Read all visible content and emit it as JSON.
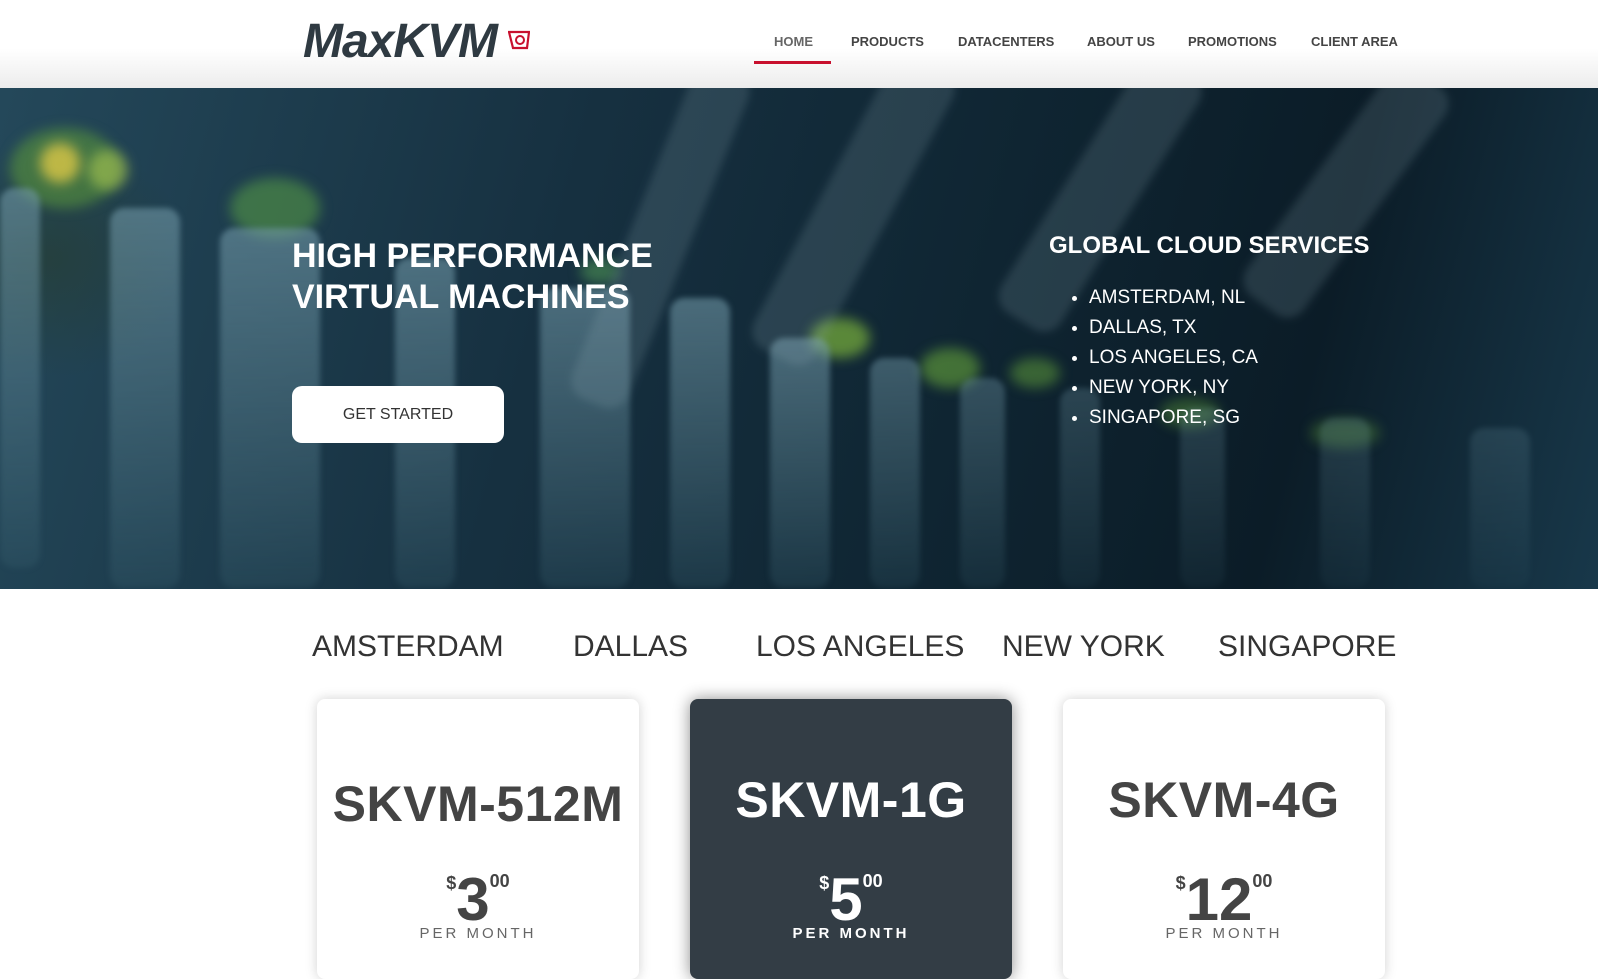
{
  "header": {
    "logo": "MaxKVM",
    "nav": [
      {
        "label": "HOME",
        "active": true
      },
      {
        "label": "PRODUCTS"
      },
      {
        "label": "DATACENTERS"
      },
      {
        "label": "ABOUT US"
      },
      {
        "label": "PROMOTIONS"
      },
      {
        "label": "CLIENT AREA"
      }
    ],
    "accent_color": "#c8102e"
  },
  "hero": {
    "title_line1": "HIGH PERFORMANCE",
    "title_line2": "VIRTUAL MACHINES",
    "button": "GET STARTED",
    "locations_title": "GLOBAL CLOUD SERVICES",
    "locations": [
      "AMSTERDAM, NL",
      "DALLAS, TX",
      "LOS ANGELES, CA",
      "NEW YORK, NY",
      "SINGAPORE, SG"
    ]
  },
  "tabs": [
    "AMSTERDAM",
    "DALLAS",
    "LOS ANGELES",
    "NEW YORK",
    "SINGAPORE"
  ],
  "plans": [
    {
      "name": "SKVM-512M",
      "currency": "$",
      "price": "3",
      "cents": "00",
      "period": "PER MONTH",
      "featured": false
    },
    {
      "name": "SKVM-1G",
      "currency": "$",
      "price": "5",
      "cents": "00",
      "period": "PER MONTH",
      "featured": true
    },
    {
      "name": "SKVM-4G",
      "currency": "$",
      "price": "12",
      "cents": "00",
      "period": "PER MONTH",
      "featured": false
    }
  ],
  "colors": {
    "dark_card": "#333d45",
    "hero_dark": "#0f2532"
  }
}
